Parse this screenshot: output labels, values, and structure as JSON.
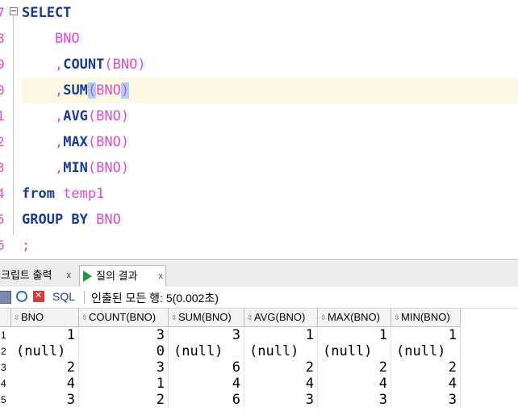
{
  "editor": {
    "line_numbers": [
      "7",
      "8",
      "9",
      "0",
      "1",
      "2",
      "3",
      "4",
      "5",
      "6"
    ],
    "lines": [
      [
        {
          "t": "SELECT",
          "c": "kw"
        }
      ],
      [
        {
          "t": "    ",
          "c": ""
        },
        {
          "t": "BNO",
          "c": "id"
        }
      ],
      [
        {
          "t": "    ",
          "c": ""
        },
        {
          "t": ",",
          "c": "id"
        },
        {
          "t": "COUNT",
          "c": "kw"
        },
        {
          "t": "(BNO)",
          "c": "id"
        }
      ],
      [
        {
          "t": "    ",
          "c": ""
        },
        {
          "t": ",",
          "c": "id"
        },
        {
          "t": "SUM",
          "c": "kw"
        },
        {
          "t": "(",
          "c": "hl"
        },
        {
          "t": "BNO",
          "c": "id"
        },
        {
          "t": ")",
          "c": "hl"
        }
      ],
      [
        {
          "t": "    ",
          "c": ""
        },
        {
          "t": ",",
          "c": "id"
        },
        {
          "t": "AVG",
          "c": "kw"
        },
        {
          "t": "(BNO)",
          "c": "id"
        }
      ],
      [
        {
          "t": "    ",
          "c": ""
        },
        {
          "t": ",",
          "c": "id"
        },
        {
          "t": "MAX",
          "c": "kw"
        },
        {
          "t": "(BNO)",
          "c": "id"
        }
      ],
      [
        {
          "t": "    ",
          "c": ""
        },
        {
          "t": ",",
          "c": "id"
        },
        {
          "t": "MIN",
          "c": "kw"
        },
        {
          "t": "(BNO)",
          "c": "id"
        }
      ],
      [
        {
          "t": "from",
          "c": "kw"
        },
        {
          "t": " temp1",
          "c": "id"
        }
      ],
      [
        {
          "t": "GROUP BY",
          "c": "kw"
        },
        {
          "t": " BNO",
          "c": "id"
        }
      ],
      [
        {
          "t": ";",
          "c": "id"
        }
      ]
    ],
    "colors": {
      "keyword": "#1c3b8c",
      "identifier": "#d850c8",
      "current_line": "#fdf8e1",
      "bracket_match": "#a8d0f8"
    }
  },
  "tabs": {
    "script_output": {
      "label": "크립트 출력",
      "close": "x"
    },
    "query_result": {
      "label": "질의 결과",
      "close": "x",
      "icon": "play-icon"
    }
  },
  "toolbar": {
    "sql_label": "SQL",
    "status": "인출된 모든 행: 5(0.002초)",
    "icons": [
      "print-icon",
      "refresh-icon",
      "cancel-icon"
    ]
  },
  "grid": {
    "columns": [
      "BNO",
      "COUNT(BNO)",
      "SUM(BNO)",
      "AVG(BNO)",
      "MAX(BNO)",
      "MIN(BNO)"
    ],
    "rows": [
      {
        "n": "1",
        "cells": [
          "1",
          "3",
          "3",
          "1",
          "1",
          "1"
        ]
      },
      {
        "n": "2",
        "cells": [
          "(null)",
          "0",
          "(null)",
          "(null)",
          "(null)",
          "(null)"
        ]
      },
      {
        "n": "3",
        "cells": [
          "2",
          "3",
          "6",
          "2",
          "2",
          "2"
        ]
      },
      {
        "n": "4",
        "cells": [
          "4",
          "1",
          "4",
          "4",
          "4",
          "4"
        ]
      },
      {
        "n": "5",
        "cells": [
          "3",
          "2",
          "6",
          "3",
          "3",
          "3"
        ]
      }
    ]
  }
}
